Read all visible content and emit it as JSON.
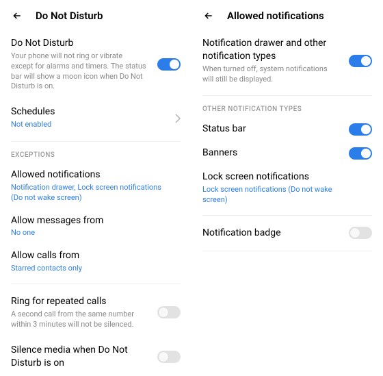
{
  "left": {
    "title": "Do Not Disturb",
    "dnd": {
      "title": "Do Not Disturb",
      "desc": "Your phone will not ring or vibrate except for alarms and timers. The status bar will show a moon icon when Do Not Disturb is on."
    },
    "schedules": {
      "title": "Schedules",
      "value": "Not enabled"
    },
    "section_exceptions": "EXCEPTIONS",
    "allowed": {
      "title": "Allowed notifications",
      "value": "Notification drawer, Lock screen notifications (Do not wake screen)"
    },
    "messages": {
      "title": "Allow messages from",
      "value": "No one"
    },
    "calls": {
      "title": "Allow calls from",
      "value": "Starred contacts only"
    },
    "repeated": {
      "title": "Ring for repeated calls",
      "desc": "A second call from the same number within 3 minutes will not be silenced."
    },
    "silence": {
      "title": "Silence media when Do Not Disturb is on"
    }
  },
  "right": {
    "title": "Allowed notifications",
    "drawer": {
      "title": "Notification drawer and other notification types",
      "desc": "When turned off, system notifications will still be displayed."
    },
    "section_other": "OTHER NOTIFICATION TYPES",
    "status": {
      "title": "Status bar"
    },
    "banners": {
      "title": "Banners"
    },
    "lock": {
      "title": "Lock screen notifications",
      "value": "Lock screen notifications (Do not wake screen)"
    },
    "badge": {
      "title": "Notification badge"
    }
  }
}
